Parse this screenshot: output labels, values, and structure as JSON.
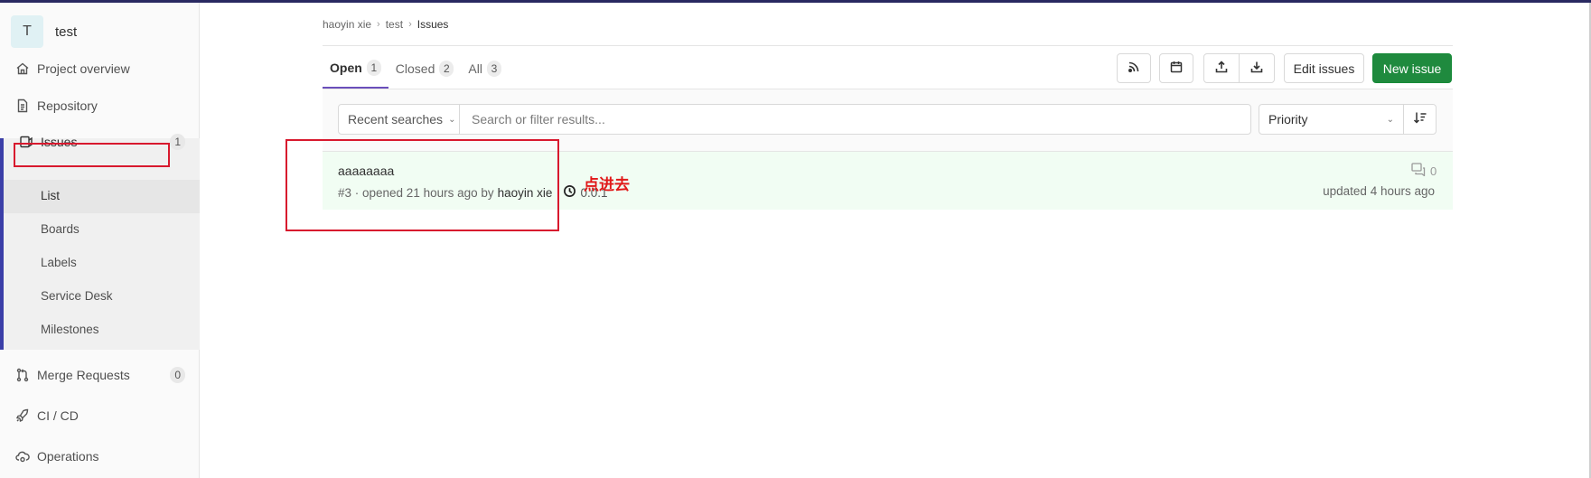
{
  "project": {
    "avatar_letter": "T",
    "name": "test"
  },
  "sidebar": {
    "items": [
      {
        "label": "Project overview",
        "icon": "home-icon"
      },
      {
        "label": "Repository",
        "icon": "document-icon"
      },
      {
        "label": "Issues",
        "icon": "issues-icon",
        "count": "1"
      },
      {
        "label": "Merge Requests",
        "icon": "git-merge-icon",
        "count": "0"
      },
      {
        "label": "CI / CD",
        "icon": "rocket-icon"
      },
      {
        "label": "Operations",
        "icon": "cloud-gear-icon"
      }
    ],
    "issues_sub": [
      "List",
      "Boards",
      "Labels",
      "Service Desk",
      "Milestones"
    ],
    "active_sub": "List"
  },
  "breadcrumb": [
    "haoyin xie",
    "test",
    "Issues"
  ],
  "tabs": [
    {
      "label": "Open",
      "count": "1",
      "active": true
    },
    {
      "label": "Closed",
      "count": "2",
      "active": false
    },
    {
      "label": "All",
      "count": "3",
      "active": false
    }
  ],
  "toolbar": {
    "icons": [
      "rss-icon",
      "calendar-icon",
      "upload-icon",
      "download-icon"
    ],
    "edit_label": "Edit issues",
    "new_label": "New issue",
    "accent": "#1f8a3e"
  },
  "filter": {
    "recent_label": "Recent searches",
    "search_placeholder": "Search or filter results...",
    "sort_label": "Priority"
  },
  "issues": [
    {
      "title": "aaaaaaaa",
      "meta": "#3 · opened 21 hours ago by",
      "author": "haoyin xie",
      "milestone": "0.0.1",
      "comments": "0",
      "updated": "updated 4 hours ago"
    }
  ],
  "annotation": {
    "text": "点进去",
    "color": "#e11919"
  }
}
